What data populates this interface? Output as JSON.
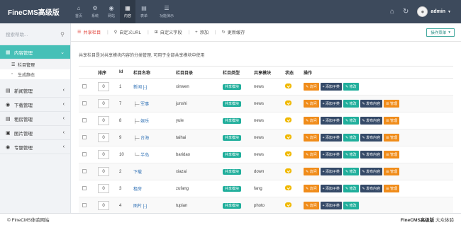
{
  "app": {
    "title": "FineCMS高级版",
    "nav": [
      {
        "label": "首页",
        "icon": "home-icon",
        "glyph": "⌂"
      },
      {
        "label": "系统",
        "icon": "gear-icon",
        "glyph": "⚙"
      },
      {
        "label": "网站",
        "icon": "globe-icon",
        "glyph": "◉"
      },
      {
        "label": "内容",
        "icon": "grid-icon",
        "glyph": "▦"
      },
      {
        "label": "表单",
        "icon": "table-icon",
        "glyph": "▤"
      },
      {
        "label": "功能演示",
        "icon": "list-icon",
        "glyph": "☰"
      }
    ],
    "user": "admin"
  },
  "sidebar": {
    "search_placeholder": "搜索帮助...",
    "content_manage": "内容管理",
    "sub": [
      "栏目管理",
      "生成静态"
    ],
    "groups": [
      "新闻管理",
      "下载管理",
      "租房管理",
      "图片管理",
      "专题管理"
    ]
  },
  "tabs": [
    "共享栏目",
    "自定义URL",
    "自定义字段",
    "添加",
    "更新缓存"
  ],
  "op_menu": "操作菜单",
  "notice": "共享栏目是对共享模块内容的分类管理, 可用于全部共享模块中使用",
  "table": {
    "headers": [
      "",
      "排序",
      "Id",
      "栏目名称",
      "栏目目录",
      "栏目类型",
      "共享模块",
      "状态",
      "操作"
    ],
    "rows": [
      {
        "order": "0",
        "id": "1",
        "prefix": "",
        "name": "新闻",
        "suffix": " [-]",
        "dir": "xinwen",
        "type": "共享模块",
        "module": "news",
        "buttons": [
          "访问",
          "添加子类",
          "修改"
        ]
      },
      {
        "order": "0",
        "id": "7",
        "prefix": "├─ ",
        "name": "军事",
        "suffix": "",
        "dir": "junshi",
        "type": "共享模块",
        "module": "news",
        "buttons": [
          "访问",
          "添加子类",
          "修改",
          "发布内容",
          "管理"
        ]
      },
      {
        "order": "0",
        "id": "8",
        "prefix": "├─ ",
        "name": "娱乐",
        "suffix": "",
        "dir": "yule",
        "type": "共享模块",
        "module": "news",
        "buttons": [
          "访问",
          "添加子类",
          "修改",
          "发布内容",
          "管理"
        ]
      },
      {
        "order": "0",
        "id": "9",
        "prefix": "├─ ",
        "name": "台海",
        "suffix": "",
        "dir": "taihai",
        "type": "共享模块",
        "module": "news",
        "buttons": [
          "访问",
          "添加子类",
          "修改",
          "发布内容",
          "管理"
        ]
      },
      {
        "order": "0",
        "id": "10",
        "prefix": "└─ ",
        "name": "半岛",
        "suffix": "",
        "dir": "baridao",
        "type": "共享模块",
        "module": "news",
        "buttons": [
          "访问",
          "添加子类",
          "修改",
          "发布内容",
          "管理"
        ]
      },
      {
        "order": "0",
        "id": "2",
        "prefix": "",
        "name": "下载",
        "suffix": "",
        "dir": "xiazai",
        "type": "共享模块",
        "module": "down",
        "buttons": [
          "访问",
          "添加子类",
          "修改",
          "发布内容",
          "管理"
        ]
      },
      {
        "order": "0",
        "id": "3",
        "prefix": "",
        "name": "租房",
        "suffix": "",
        "dir": "zufang",
        "type": "共享模块",
        "module": "fang",
        "buttons": [
          "访问",
          "添加子类",
          "修改",
          "发布内容",
          "管理"
        ]
      },
      {
        "order": "0",
        "id": "4",
        "prefix": "",
        "name": "图片",
        "suffix": " [-]",
        "dir": "tupian",
        "type": "共享模块",
        "module": "photo",
        "buttons": [
          "访问",
          "添加子类",
          "修改"
        ]
      }
    ]
  },
  "footer": {
    "left": "© FineCMS体验网站",
    "right_bold": "FineCMS高级版",
    "right_rest": "大众体验"
  }
}
